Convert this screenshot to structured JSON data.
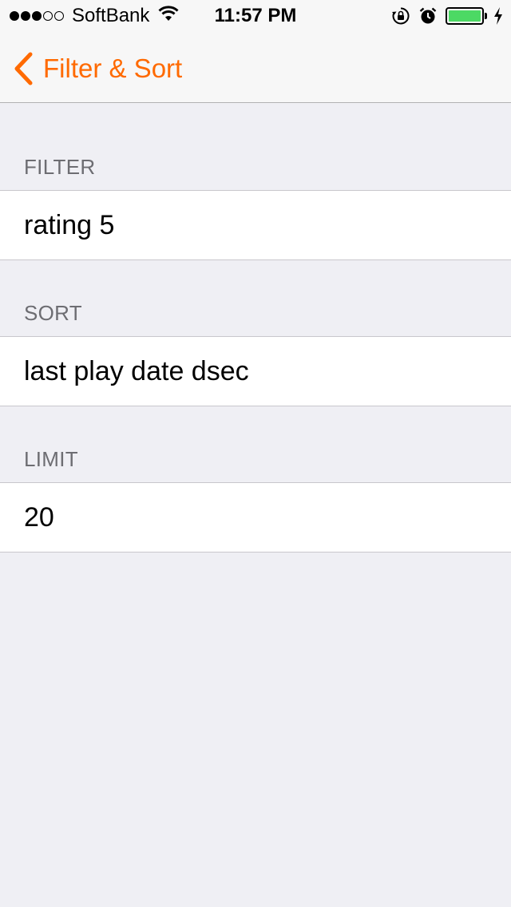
{
  "status_bar": {
    "carrier": "SoftBank",
    "time": "11:57 PM",
    "signal_bars_filled": 3,
    "signal_bars_total": 5,
    "battery_level": 1.0,
    "battery_color": "#4cd964",
    "icons": [
      "wifi-icon",
      "orientation-lock-icon",
      "alarm-icon",
      "battery-icon",
      "charging-bolt-icon"
    ]
  },
  "nav": {
    "back_label": "Filter & Sort",
    "accent_color": "#ff6a00",
    "back_icon": "chevron-left-icon"
  },
  "sections": [
    {
      "header": "FILTER",
      "value": "rating 5"
    },
    {
      "header": "SORT",
      "value": "last play date dsec"
    },
    {
      "header": "LIMIT",
      "value": "20"
    }
  ]
}
